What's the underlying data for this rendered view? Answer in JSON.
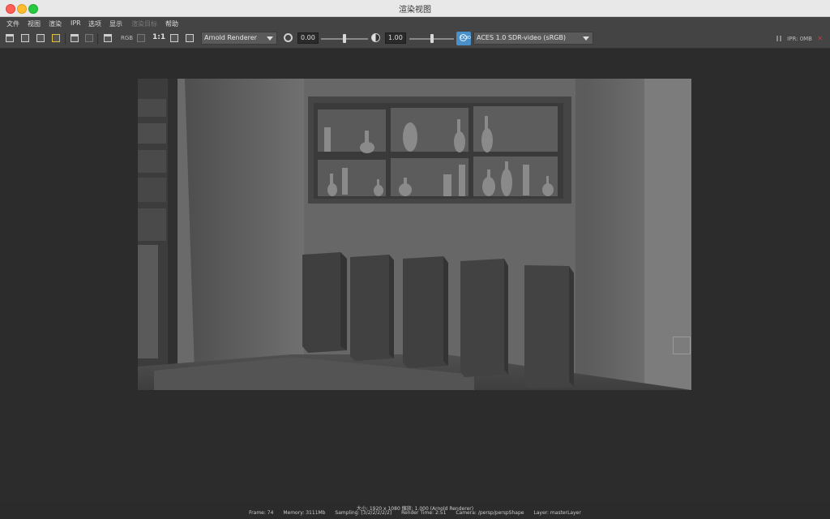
{
  "window": {
    "title": "渲染视图"
  },
  "menu": {
    "items": [
      {
        "label": "文件",
        "enabled": true
      },
      {
        "label": "视图",
        "enabled": true
      },
      {
        "label": "渲染",
        "enabled": true
      },
      {
        "label": "IPR",
        "enabled": true
      },
      {
        "label": "选项",
        "enabled": true
      },
      {
        "label": "显示",
        "enabled": true
      },
      {
        "label": "渲染目标",
        "enabled": false
      },
      {
        "label": "帮助",
        "enabled": true
      }
    ]
  },
  "toolbar": {
    "renderer": "Arnold Renderer",
    "exposure": "0.00",
    "gamma": "1.00",
    "color_space": "ACES 1.0 SDR-video (sRGB)",
    "rgb_label": "RGB",
    "one_to_one": "1:1",
    "ipr_memory": "IPR: 0MB",
    "ocio_label": "OCIO"
  },
  "status": {
    "line1": "大小: 1920 x 1080 缩放: 1.000     (Arnold Renderer)",
    "frame": "Frame: 74",
    "memory": "Memory: 3111Mb",
    "sampling": "Sampling: [3/2/2/2/2/2]",
    "render_time": "Render Time: 2:51",
    "camera": "Camera: /persp/perspShape",
    "layer": "Layer: masterLayer"
  }
}
